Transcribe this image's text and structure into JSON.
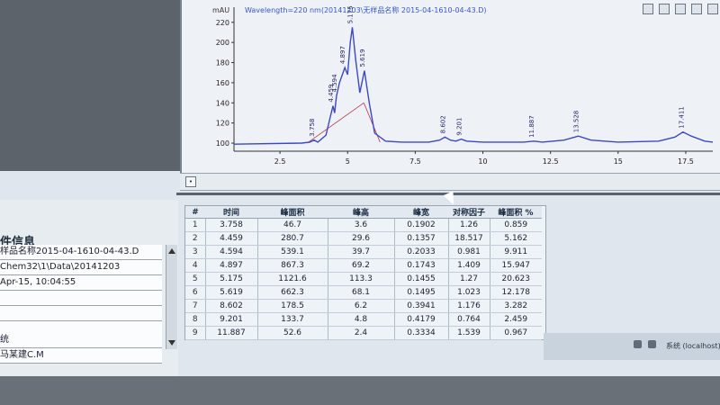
{
  "chart": {
    "title": "Wavelength=220 nm(20141203\\无样品名称 2015-04-1610-04-43.D)",
    "y_unit": "mAU",
    "y_ticks": [
      "100",
      "120",
      "140",
      "160",
      "180",
      "200",
      "220"
    ],
    "x_ticks": [
      "2.5",
      "5",
      "7.5",
      "10",
      "12.5",
      "15",
      "17.5"
    ],
    "peak_labels": [
      "3.758",
      "4.459",
      "4.594",
      "4.897",
      "5.175",
      "5.619",
      "8.602",
      "9.201",
      "11.887",
      "13.528",
      "17.411"
    ]
  },
  "chart_data": {
    "type": "line",
    "title": "Wavelength=220 nm(20141203\\无样品名称 2015-04-1610-04-43.D)",
    "xlabel": "",
    "ylabel": "mAU",
    "xlim": [
      0.8,
      18.5
    ],
    "ylim": [
      92,
      235
    ],
    "series": [
      {
        "x": [
          0.8,
          3.3,
          3.6,
          3.76,
          3.9,
          4.2,
          4.35,
          4.46,
          4.52,
          4.59,
          4.7,
          4.9,
          5.0,
          5.1,
          5.175,
          5.3,
          5.45,
          5.62,
          5.8,
          6.0,
          6.4,
          7.0,
          8.0,
          8.4,
          8.6,
          8.8,
          9.0,
          9.2,
          9.4,
          10.0,
          11.5,
          11.89,
          12.2,
          13.0,
          13.53,
          14.0,
          15.0,
          16.5,
          17.1,
          17.4,
          17.7,
          18.2,
          18.5
        ],
        "y": [
          99,
          100,
          101,
          103,
          101,
          108,
          125,
          137,
          130,
          147,
          160,
          175,
          168,
          200,
          215,
          182,
          150,
          172,
          140,
          110,
          102,
          101,
          101,
          103,
          106,
          103,
          102,
          104,
          102,
          101,
          101,
          102,
          101,
          103,
          107,
          103,
          101,
          102,
          106,
          111,
          107,
          102,
          101
        ]
      }
    ]
  },
  "info": {
    "heading": "件信息",
    "sample_name": "样品名称2015-04-1610-04-43.D",
    "path": "Chem32\\1\\Data\\20141203",
    "datetime": "Apr-15, 10:04:55",
    "bottom_label": "统",
    "operator": "马某建C.M"
  },
  "table": {
    "headers": [
      "#",
      "时间",
      "峰面积",
      "峰高",
      "峰宽",
      "对称因子",
      "峰面积 %"
    ],
    "rows": [
      [
        "1",
        "3.758",
        "46.7",
        "3.6",
        "0.1902",
        "1.26",
        "0.859"
      ],
      [
        "2",
        "4.459",
        "280.7",
        "29.6",
        "0.1357",
        "18.517",
        "5.162"
      ],
      [
        "3",
        "4.594",
        "539.1",
        "39.7",
        "0.2033",
        "0.981",
        "9.911"
      ],
      [
        "4",
        "4.897",
        "867.3",
        "69.2",
        "0.1743",
        "1.409",
        "15.947"
      ],
      [
        "5",
        "5.175",
        "1121.6",
        "113.3",
        "0.1455",
        "1.27",
        "20.623"
      ],
      [
        "6",
        "5.619",
        "662.3",
        "68.1",
        "0.1495",
        "1.023",
        "12.178"
      ],
      [
        "7",
        "8.602",
        "178.5",
        "6.2",
        "0.3941",
        "1.176",
        "3.282"
      ],
      [
        "8",
        "9.201",
        "133.7",
        "4.8",
        "0.4179",
        "0.764",
        "2.459"
      ],
      [
        "9",
        "11.887",
        "52.6",
        "2.4",
        "0.3334",
        "1.539",
        "0.967"
      ]
    ]
  },
  "taskbar": {
    "host_text": "系统 (localhost)"
  },
  "colors": {
    "signal": "#3c48c2",
    "baseline": "#b23a4a",
    "labels": "#2a2a66"
  }
}
